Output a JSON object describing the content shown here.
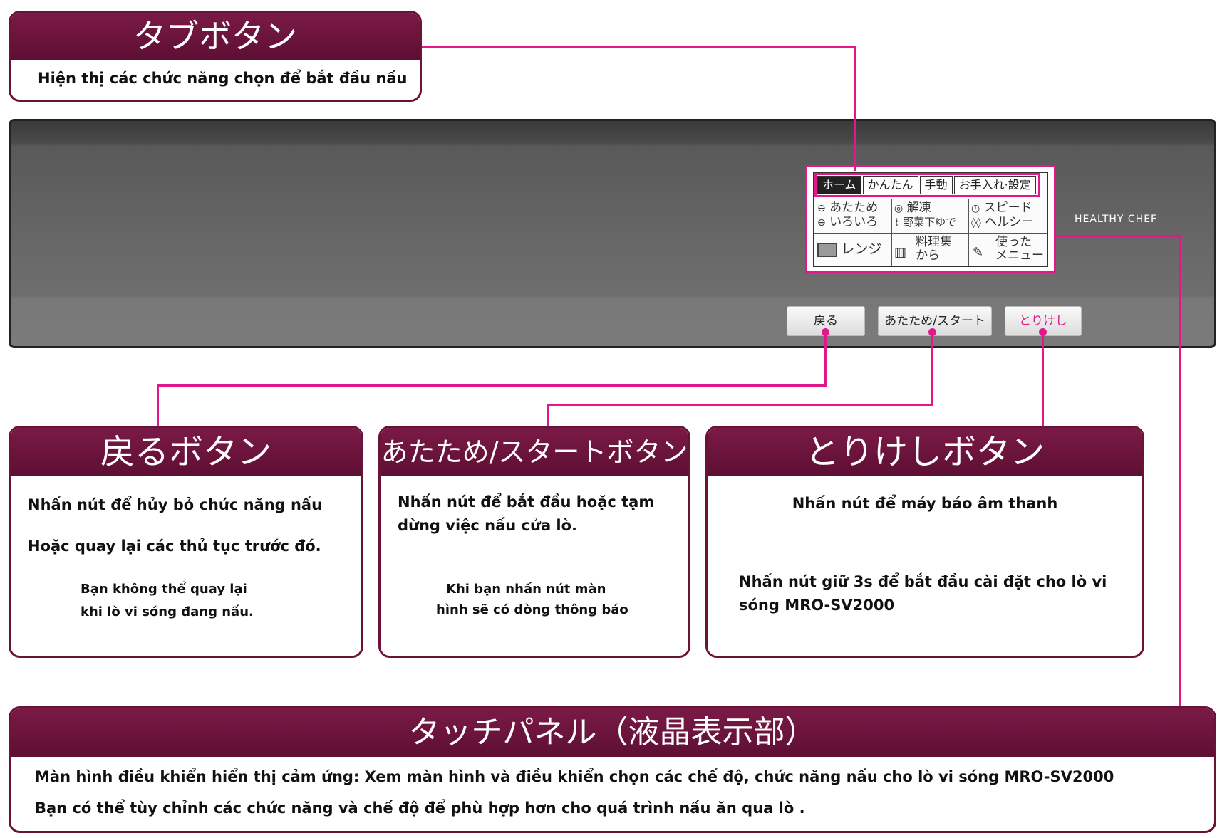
{
  "tab_callout": {
    "title": "タブボタン",
    "desc": "Hiện thị các chức năng chọn để bắt đầu nấu"
  },
  "device": {
    "brand": "HEALTHY CHEF",
    "tabs": [
      "ホーム",
      "かんたん",
      "手動",
      "お手入れ·設定"
    ],
    "grid": [
      {
        "l1": "あたため",
        "l2": "いろいろ"
      },
      {
        "l1": "解凍",
        "l2": "野菜下ゆで"
      },
      {
        "l1": "スピード",
        "l2": "ヘルシー"
      },
      {
        "l1": "レンジ",
        "l2": ""
      },
      {
        "l1": "料理集",
        "l2": "から"
      },
      {
        "l1": "使った",
        "l2": "メニュー"
      }
    ],
    "buttons": {
      "back": "戻る",
      "start": "あたため/スタート",
      "cancel": "とりけし"
    }
  },
  "back_callout": {
    "title": "戻るボタン",
    "p1": "Nhấn nút để hủy bỏ chức năng nấu",
    "p2": "Hoặc quay lại các thủ tục trước đó.",
    "n1": "Bạn không thể quay lại",
    "n2": "khi lò vi sóng đang nấu."
  },
  "start_callout": {
    "title": "あたため/スタートボタン",
    "p1": "Nhấn nút để bắt đầu hoặc tạm",
    "p2": "dừng việc nấu cửa lò.",
    "n1": "Khi bạn nhấn nút màn",
    "n2": "hình sẽ có dòng thông báo"
  },
  "cancel_callout": {
    "title": "とりけしボタン",
    "p1": "Nhấn nút để máy báo âm thanh",
    "p2": "Nhấn nút giữ 3s để bắt đầu cài đặt cho lò vi",
    "p3": "sóng MRO-SV2000"
  },
  "panel_callout": {
    "title": "タッチパネル（液晶表示部）",
    "p1": "Màn hình điều khiển hiển thị cảm ứng: Xem màn hình và điều khiển chọn các chế độ, chức năng nấu cho lò vi sóng MRO-SV2000",
    "p2": "Bạn có thể tùy chỉnh các chức năng và chế độ để phù hợp hơn cho quá trình nấu ăn qua lò ."
  },
  "colors": {
    "accent": "#e0188a",
    "header": "#6a1238"
  }
}
